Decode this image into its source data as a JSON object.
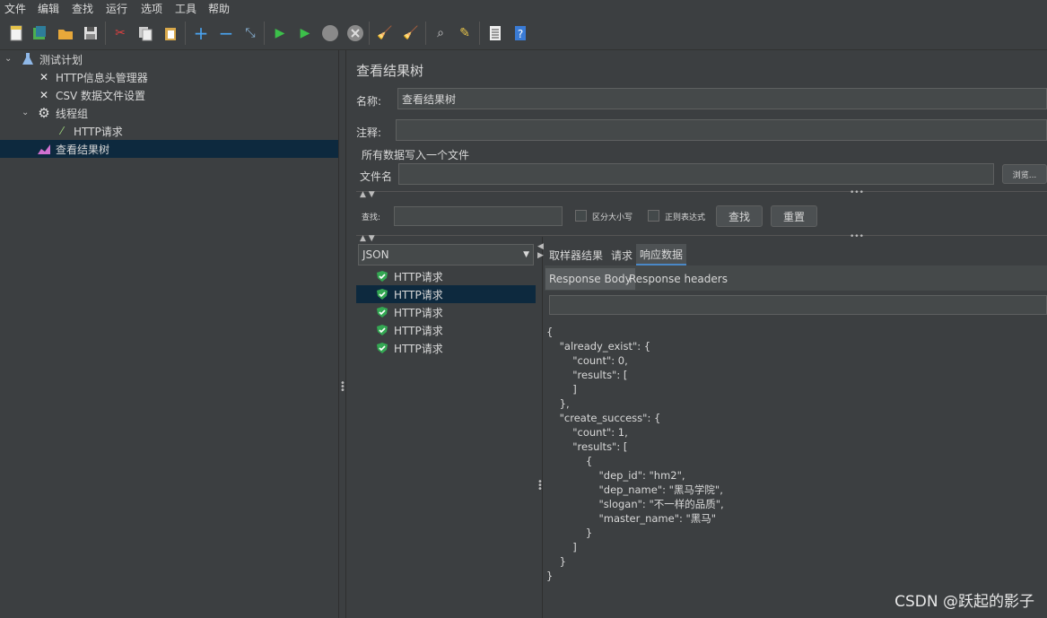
{
  "menu": [
    "文件",
    "编辑",
    "查找",
    "运行",
    "选项",
    "工具",
    "帮助"
  ],
  "toolbar": {
    "icons": [
      "new-icon",
      "templates-icon",
      "open-icon",
      "save-icon",
      "cut-icon",
      "copy-icon",
      "paste-icon",
      "expand-icon",
      "collapse-icon",
      "toggle-icon",
      "start-icon",
      "start-no-pause-icon",
      "stop-icon",
      "shutdown-icon",
      "clear-icon",
      "clear-all-icon",
      "search-icon",
      "reset-search-icon",
      "function-helper-icon",
      "help-icon"
    ]
  },
  "tree": {
    "items": [
      {
        "label": "测试计划",
        "icon": "flask-icon"
      },
      {
        "label": "HTTP信息头管理器",
        "icon": "wrench-icon"
      },
      {
        "label": "CSV 数据文件设置",
        "icon": "wrench-icon"
      },
      {
        "label": "线程组",
        "icon": "gear-icon"
      },
      {
        "label": "HTTP请求",
        "icon": "pipette-icon"
      },
      {
        "label": "查看结果树",
        "icon": "chart-icon"
      }
    ]
  },
  "panel": {
    "title": "查看结果树",
    "name_label": "名称:",
    "name_value": "查看结果树",
    "comment_label": "注释:",
    "comment_value": "",
    "file_section": "所有数据写入一个文件",
    "file_label": "文件名",
    "file_value": "",
    "browse_label": "浏览...",
    "search_label": "查找:",
    "search_value": "",
    "case_label": "区分大小写",
    "regex_label": "正则表达式",
    "find_button": "查找",
    "reset_button": "重置"
  },
  "renderer": {
    "selected": "JSON"
  },
  "results": [
    {
      "label": "HTTP请求",
      "status": "success"
    },
    {
      "label": "HTTP请求",
      "status": "success"
    },
    {
      "label": "HTTP请求",
      "status": "success"
    },
    {
      "label": "HTTP请求",
      "status": "success"
    },
    {
      "label": "HTTP请求",
      "status": "success"
    }
  ],
  "tabs": {
    "main": [
      "取样器结果",
      "请求",
      "响应数据"
    ],
    "sub": [
      "Response Body",
      "Response headers"
    ]
  },
  "response_search": "",
  "json_lines": [
    "{",
    "    \"already_exist\": {",
    "        \"count\": 0,",
    "        \"results\": [",
    "        ]",
    "    },",
    "    \"create_success\": {",
    "        \"count\": 1,",
    "        \"results\": [",
    "            {",
    "                \"dep_id\": \"hm2\",",
    "                \"dep_name\": \"黑马学院\",",
    "                \"slogan\": \"不一样的品质\",",
    "                \"master_name\": \"黑马\"",
    "            }",
    "        ]",
    "    }",
    "}"
  ],
  "watermark": "CSDN @跃起的影子"
}
